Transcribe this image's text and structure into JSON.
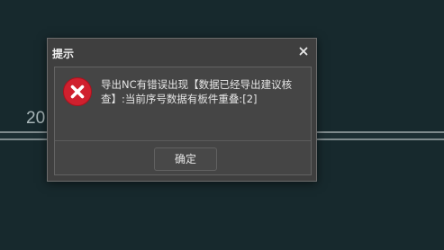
{
  "background": {
    "year_fragment": "20"
  },
  "dialog": {
    "title": "提示",
    "close_glyph": "×",
    "icon": "error-icon",
    "message": "导出NC有错误出现【数据已经导出建议核查】:当前序号数据有板件重叠:[2]",
    "ok_label": "确定"
  },
  "colors": {
    "page_bg": "#17292d",
    "dialog_bg": "#3f3f3f",
    "error_red": "#d0202e",
    "text": "#e6e6e6"
  }
}
